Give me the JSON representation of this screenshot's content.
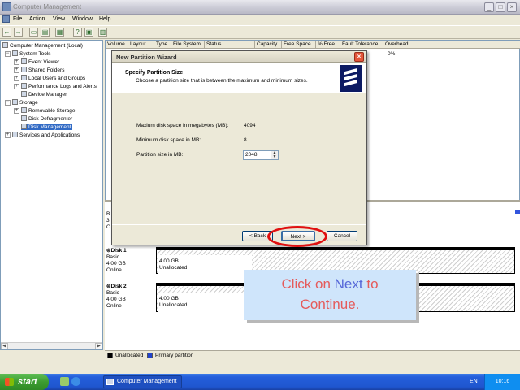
{
  "window": {
    "title": "Computer Management"
  },
  "menu": [
    "File",
    "Action",
    "View",
    "Window",
    "Help"
  ],
  "tree": [
    "Computer Management (Local)",
    "System Tools",
    "Event Viewer",
    "Shared Folders",
    "Local Users and Groups",
    "Performance Logs and Alerts",
    "Device Manager",
    "Storage",
    "Removable Storage",
    "Disk Defragmenter",
    "Disk Management",
    "Services and Applications"
  ],
  "columns": [
    "Volume",
    "Layout",
    "Type",
    "File System",
    "Status",
    "Capacity",
    "Free Space",
    "% Free",
    "Fault Tolerance",
    "Overhead"
  ],
  "overhead_value": "0%",
  "disks": [
    {
      "name": "Disk 1",
      "type": "Basic",
      "size": "4.00 GB",
      "status": "Online",
      "vol_size": "4.00 GB",
      "vol_state": "Unallocated"
    },
    {
      "name": "Disk 2",
      "type": "Basic",
      "size": "4.00 GB",
      "status": "Online",
      "vol_size": "4.00 GB",
      "vol_state": "Unallocated"
    }
  ],
  "partial_disk_label": {
    "line1": "B",
    "line2": "3",
    "line3": "O"
  },
  "legend": {
    "unallocated": "Unallocated",
    "primary": "Primary partition"
  },
  "dialog": {
    "title": "New Partition Wizard",
    "heading": "Specify Partition Size",
    "subheading": "Choose a partition size that is between the maximum and minimum sizes.",
    "max_label": "Maxium disk space in megabytes (MB):",
    "max_value": "4094",
    "min_label": "Minimum disk space in MB:",
    "min_value": "8",
    "size_label": "Partition size in MB:",
    "size_value": "2048",
    "back": "< Back",
    "next": "Next >",
    "cancel": "Cancel",
    "close": "×"
  },
  "callout": {
    "pre": "Click on ",
    "highlight": "Next",
    "post": " to",
    "line2": "Continue."
  },
  "taskbar": {
    "start": "start",
    "task": "Computer Management",
    "lang": "EN",
    "time": "10:16"
  },
  "colors": {
    "accent": "#316ac5",
    "callout_text": "#e55b5b",
    "callout_highlight": "#5567d8",
    "oval": "#e01010"
  }
}
